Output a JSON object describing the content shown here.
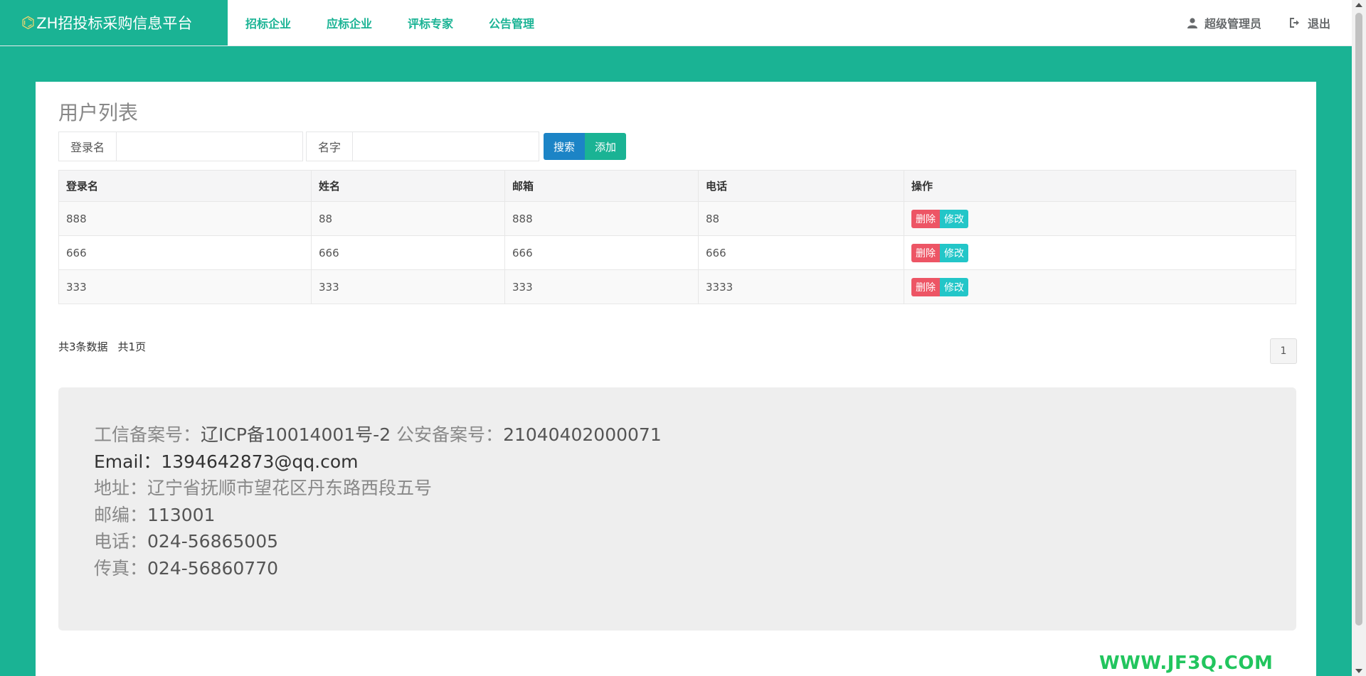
{
  "header": {
    "logo_glyph": "⌬",
    "brand": "ZH招投标采购信息平台",
    "nav": [
      "招标企业",
      "应标企业",
      "评标专家",
      "公告管理"
    ],
    "user": "超级管理员",
    "logout": "退出"
  },
  "page": {
    "title": "用户列表",
    "search": {
      "login_label": "登录名",
      "login_value": "",
      "name_label": "名字",
      "name_value": "",
      "search_button": "搜索",
      "add_button": "添加"
    },
    "table": {
      "columns": [
        "登录名",
        "姓名",
        "邮箱",
        "电话",
        "操作"
      ],
      "rows": [
        [
          "888",
          "88",
          "888",
          "88"
        ],
        [
          "666",
          "666",
          "666",
          "666"
        ],
        [
          "333",
          "333",
          "333",
          "3333"
        ]
      ],
      "delete_label": "删除",
      "edit_label": "修改"
    },
    "summary": {
      "count": "共3条数据",
      "pages": "共1页"
    },
    "pagination": {
      "current": "1"
    }
  },
  "footer": {
    "icp_label": "工信备案号：",
    "icp_value": "辽ICP备10014001号-2",
    "police_label": "公安备案号：",
    "police_value": "21040402000071",
    "email_label": "Email：",
    "email_value": "1394642873@qq.com",
    "address_label": "地址：",
    "address_value": "辽宁省抚顺市望花区丹东路西段五号",
    "zip_label": "邮编：",
    "zip_value": "113001",
    "phone_label": "电话：",
    "phone_value": "024-56865005",
    "fax_label": "传真：",
    "fax_value": "024-56860770"
  },
  "watermark": "WWW.JF3Q.COM"
}
